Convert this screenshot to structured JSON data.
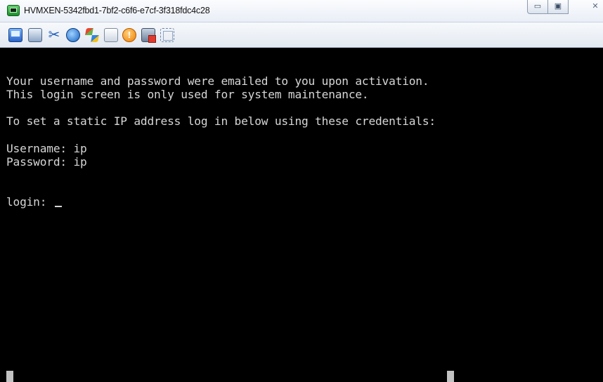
{
  "window": {
    "title": "HVMXEN-5342fbd1-7bf2-c6f6-e7cf-3f318fdc4c28",
    "controls": {
      "minimize": "▭",
      "maximize": "▣",
      "close": "✕"
    }
  },
  "toolbar": {
    "icons": [
      "console-icon",
      "windows-icon",
      "tools-icon",
      "refresh-icon",
      "windows-logo-icon",
      "drive-icon",
      "alert-icon",
      "disconnect-icon",
      "fullscreen-icon"
    ],
    "input_value": ""
  },
  "console": {
    "lines": [
      "Your username and password were emailed to you upon activation.",
      "This login screen is only used for system maintenance.",
      "To set a static IP address log in below using these credentials:",
      "Username: ip",
      "Password: ip",
      "login: "
    ]
  },
  "colors": {
    "console_bg": "#000000",
    "console_text": "#d6d6d6",
    "titlebar": "#f3f6fb"
  }
}
